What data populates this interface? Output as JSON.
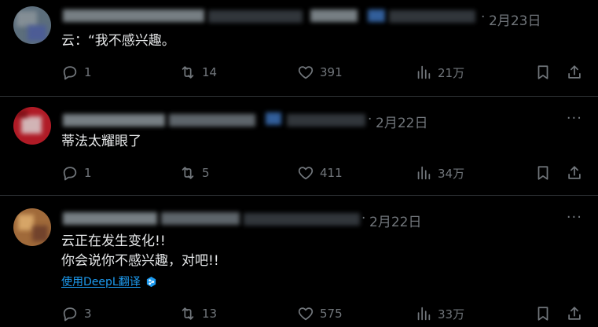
{
  "tweets": [
    {
      "date": "2月23日",
      "lines": [
        "云：“我不感兴趣。"
      ],
      "stats": {
        "replies": "1",
        "retweets": "14",
        "likes": "391",
        "views": "21万"
      }
    },
    {
      "date": "2月22日",
      "lines": [
        "蒂法太耀眼了"
      ],
      "stats": {
        "replies": "1",
        "retweets": "5",
        "likes": "411",
        "views": "34万"
      }
    },
    {
      "date": "2月22日",
      "lines": [
        "云正在发生变化!!",
        "你会说你不感兴趣，对吧!!"
      ],
      "translate_label": "使用DeepL翻译",
      "stats": {
        "replies": "3",
        "retweets": "13",
        "likes": "575",
        "views": "33万"
      }
    }
  ],
  "more_glyph": "···",
  "icons": {
    "reply": "reply-icon",
    "retweet": "retweet-icon",
    "like": "heart-icon",
    "views": "views-chart-icon",
    "bookmark": "bookmark-icon",
    "share": "share-icon"
  },
  "colors": {
    "background": "#000000",
    "text": "#e7e9ea",
    "muted": "#71767b",
    "divider": "#2f3336",
    "link": "#1d9bf0"
  }
}
